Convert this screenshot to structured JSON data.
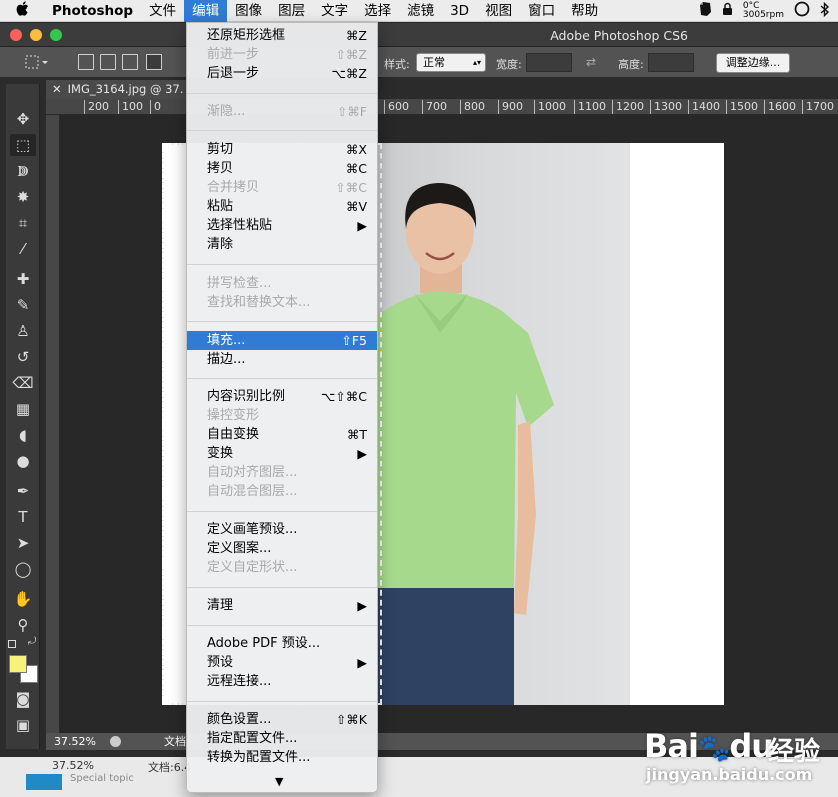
{
  "menubar": {
    "app": "Photoshop",
    "items": [
      "文件",
      "编辑",
      "图像",
      "图层",
      "文字",
      "选择",
      "滤镜",
      "3D",
      "视图",
      "窗口",
      "帮助"
    ],
    "active_index": 1,
    "cpu_temp": "0°C",
    "cpu_rpm": "3005rpm"
  },
  "window": {
    "title": "Adobe Photoshop CS6",
    "traffic_light_colors": [
      "#fc605b",
      "#fdbc40",
      "#34c84a"
    ]
  },
  "options": {
    "style_label": "样式:",
    "style_value": "正常",
    "width_label": "宽度:",
    "height_label": "高度:",
    "refine_edge_label": "调整边缘..."
  },
  "document": {
    "tab_title": "IMG_3164.jpg @ 37.",
    "ruler_ticks": [
      "200",
      "100",
      "0",
      "600",
      "700",
      "800",
      "900",
      "1000",
      "1100",
      "1200",
      "1300",
      "1400",
      "1500",
      "1600",
      "1700"
    ],
    "zoom": "37.52%",
    "doc_label": "文档",
    "zoom2": "37.52%",
    "doc_label2": "文档:6.4",
    "special_topic": "Special topic"
  },
  "colors": {
    "foreground": "#f6f27c",
    "background": "#ffffff",
    "accent": "#2f7bd6",
    "shirt": "#a7d98c"
  },
  "edit_menu": {
    "items": [
      {
        "label": "还原矩形选框",
        "shortcut": "⌘Z",
        "disabled": false
      },
      {
        "label": "前进一步",
        "shortcut": "⇧⌘Z",
        "disabled": true
      },
      {
        "label": "后退一步",
        "shortcut": "⌥⌘Z",
        "disabled": false
      },
      {
        "label": "渐隐...",
        "shortcut": "⇧⌘F",
        "disabled": true
      },
      {
        "label": "剪切",
        "shortcut": "⌘X",
        "disabled": false
      },
      {
        "label": "拷贝",
        "shortcut": "⌘C",
        "disabled": false
      },
      {
        "label": "合并拷贝",
        "shortcut": "⇧⌘C",
        "disabled": true
      },
      {
        "label": "粘贴",
        "shortcut": "⌘V",
        "disabled": false
      },
      {
        "label": "选择性粘贴",
        "shortcut": "▶",
        "disabled": false
      },
      {
        "label": "清除",
        "shortcut": "",
        "disabled": false
      },
      {
        "label": "拼写检查...",
        "shortcut": "",
        "disabled": true
      },
      {
        "label": "查找和替换文本...",
        "shortcut": "",
        "disabled": true
      },
      {
        "label": "填充...",
        "shortcut": "⇧F5",
        "disabled": false,
        "highlighted": true
      },
      {
        "label": "描边...",
        "shortcut": "",
        "disabled": false
      },
      {
        "label": "内容识别比例",
        "shortcut": "⌥⇧⌘C",
        "disabled": false
      },
      {
        "label": "操控变形",
        "shortcut": "",
        "disabled": true
      },
      {
        "label": "自由变换",
        "shortcut": "⌘T",
        "disabled": false
      },
      {
        "label": "变换",
        "shortcut": "▶",
        "disabled": false
      },
      {
        "label": "自动对齐图层...",
        "shortcut": "",
        "disabled": true
      },
      {
        "label": "自动混合图层...",
        "shortcut": "",
        "disabled": true
      },
      {
        "label": "定义画笔预设...",
        "shortcut": "",
        "disabled": false
      },
      {
        "label": "定义图案...",
        "shortcut": "",
        "disabled": false
      },
      {
        "label": "定义自定形状...",
        "shortcut": "",
        "disabled": true
      },
      {
        "label": "清理",
        "shortcut": "▶",
        "disabled": false
      },
      {
        "label": "Adobe PDF 预设...",
        "shortcut": "",
        "disabled": false
      },
      {
        "label": "预设",
        "shortcut": "▶",
        "disabled": false
      },
      {
        "label": "远程连接...",
        "shortcut": "",
        "disabled": false
      },
      {
        "label": "颜色设置...",
        "shortcut": "⇧⌘K",
        "disabled": false
      },
      {
        "label": "指定配置文件...",
        "shortcut": "",
        "disabled": false
      },
      {
        "label": "转换为配置文件...",
        "shortcut": "",
        "disabled": false
      }
    ],
    "more": "▼"
  },
  "watermark": {
    "brand": "Bai",
    "brand2": "du",
    "site_cn": "经验",
    "url": "jingyan.baidu.com"
  }
}
